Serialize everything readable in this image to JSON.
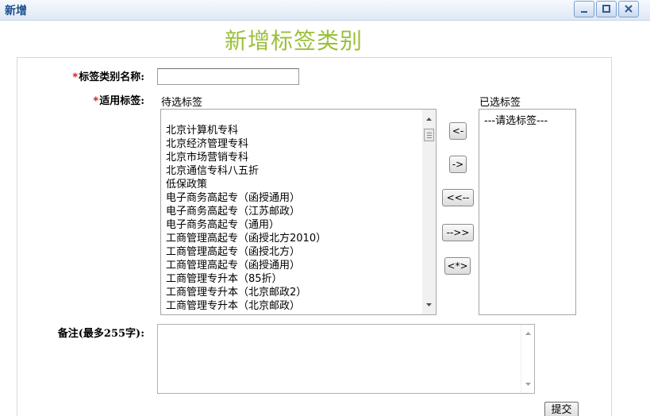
{
  "window": {
    "title": "新增",
    "controls": {
      "minimize": "minimize-icon",
      "maximize": "maximize-icon",
      "close": "close-icon"
    }
  },
  "page": {
    "heading": "新增标签类别"
  },
  "form": {
    "name_label_required": "*",
    "name_label": "标签类别名称:",
    "name_value": "",
    "tags_label_required": "*",
    "tags_label": "适用标签:",
    "available_caption": "待选标签",
    "selected_caption": "已选标签",
    "available_tags": [
      "北京计算机专科",
      "北京经济管理专科",
      "北京市场营销专科",
      "北京通信专科八五折",
      "低保政策",
      "电子商务高起专（函授通用）",
      "电子商务高起专（江苏邮政）",
      "电子商务高起专（通用）",
      "工商管理高起专（函授北方2010）",
      "工商管理高起专（函授北方）",
      "工商管理高起专（函授通用）",
      "工商管理专升本（85折）",
      "工商管理专升本（北京邮政2）",
      "工商管理专升本（北京邮政）"
    ],
    "selected_tags": [
      "---请选标签---"
    ],
    "buttons": {
      "move_left": "<-",
      "move_right": "->",
      "move_all_left": "<<--",
      "move_all_right": "-->>",
      "reset": "<*>"
    },
    "notes_label": "备注(最多255字):",
    "notes_value": "",
    "submit_label": "提交"
  }
}
